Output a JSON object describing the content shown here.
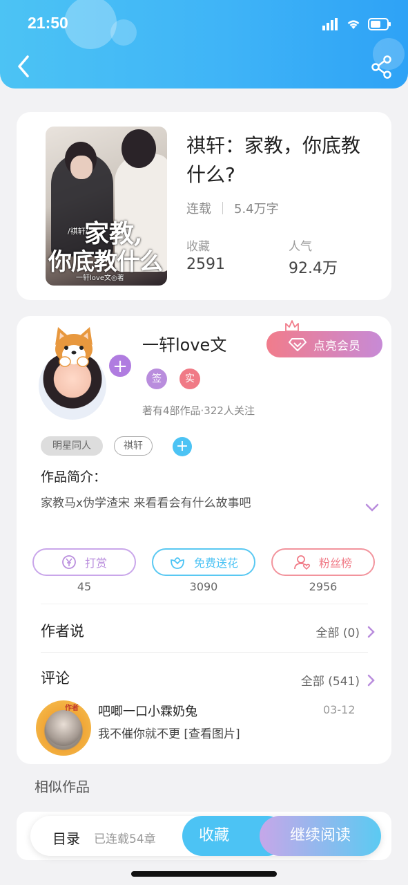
{
  "status_bar": {
    "time": "21:50"
  },
  "header": {
    "back_icon": "chevron-left-icon",
    "share_icon": "share-icon"
  },
  "book": {
    "cover": {
      "tag": "/祺轩/",
      "title_line1": "家教,",
      "title_line2": "你底教什么",
      "author": "一轩love文◎著"
    },
    "title": "祺轩：家教，你底教什么?",
    "status": "连载",
    "word_count": "5.4万字",
    "stats": [
      {
        "label": "收藏",
        "value": "2591"
      },
      {
        "label": "人气",
        "value": "92.4万"
      }
    ]
  },
  "author": {
    "name": "一轩love文",
    "vip_button": "点亮会员",
    "badges": [
      {
        "text": "签",
        "color": "#b98ddd"
      },
      {
        "text": "实",
        "color": "#f07a86"
      }
    ],
    "stats_text": "著有4部作品·322人关注"
  },
  "tags": [
    "明星同人",
    "祺轩"
  ],
  "intro": {
    "label": "作品简介：",
    "text": "家教马x伪学渣宋 来看看会有什么故事吧"
  },
  "actions": [
    {
      "label": "打赏",
      "count": "45",
      "color": "#b98ddd",
      "icon": "yuan-coin-icon"
    },
    {
      "label": "免费送花",
      "count": "3090",
      "color": "#4cc3f4",
      "icon": "flower-icon"
    },
    {
      "label": "粉丝榜",
      "count": "2956",
      "color": "#f07a86",
      "icon": "fan-user-icon"
    }
  ],
  "author_says": {
    "label": "作者说",
    "link": "全部 (0)"
  },
  "comments": {
    "label": "评论",
    "link": "全部 (541)",
    "items": [
      {
        "user": "吧唧一口小霖奶兔",
        "date": "03-12",
        "text": "我不催你就不更 [查看图片]",
        "badge": "作者"
      }
    ]
  },
  "similar": {
    "label": "相似作品"
  },
  "bottom_bar": {
    "toc_label": "目录",
    "toc_sub": "已连载54章",
    "collect": "收藏",
    "read": "继续阅读"
  }
}
